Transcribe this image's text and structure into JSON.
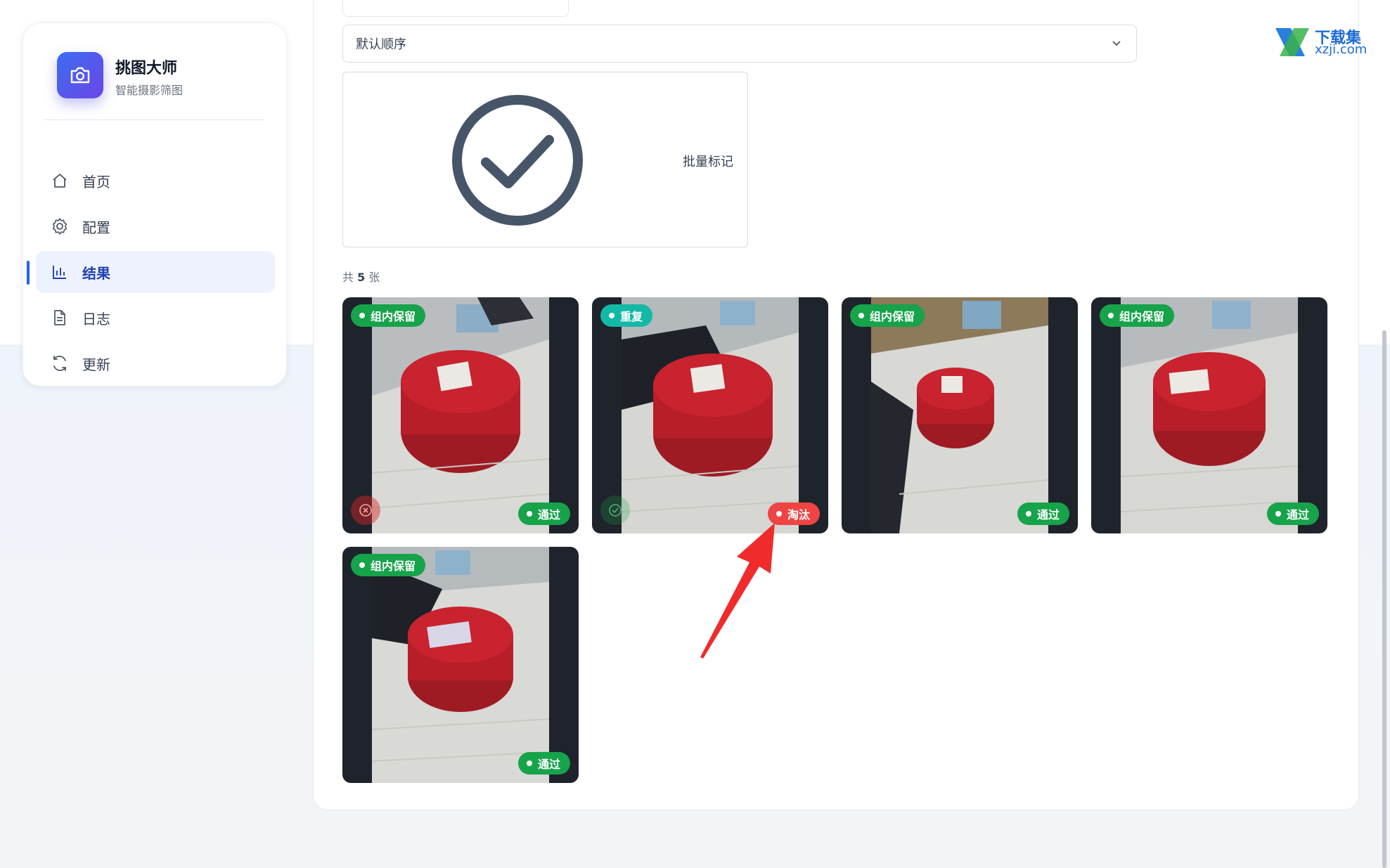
{
  "app": {
    "title": "挑图大师",
    "subtitle": "智能摄影筛图"
  },
  "sidebar": {
    "items": [
      {
        "label": "首页",
        "icon": "home-icon",
        "active": false
      },
      {
        "label": "配置",
        "icon": "gear-icon",
        "active": false
      },
      {
        "label": "结果",
        "icon": "bar-chart-icon",
        "active": true
      },
      {
        "label": "日志",
        "icon": "document-icon",
        "active": false
      },
      {
        "label": "更新",
        "icon": "refresh-icon",
        "active": false
      }
    ]
  },
  "toolbar": {
    "sort_select": {
      "value": "默认顺序"
    },
    "batch_label": "批量标记"
  },
  "results": {
    "count_prefix": "共",
    "count_value": "5",
    "count_suffix": "张",
    "cards": [
      {
        "top_tag": "组内保留",
        "bottom_tag": "通过",
        "top_status": "keep",
        "bottom_status": "pass",
        "mini": "x-circle"
      },
      {
        "top_tag": "重复",
        "bottom_tag": "淘汰",
        "top_status": "duplicate",
        "bottom_status": "reject",
        "mini": "check-circle"
      },
      {
        "top_tag": "组内保留",
        "bottom_tag": "通过",
        "top_status": "keep",
        "bottom_status": "pass"
      },
      {
        "top_tag": "组内保留",
        "bottom_tag": "通过",
        "top_status": "keep",
        "bottom_status": "pass"
      },
      {
        "top_tag": "组内保留",
        "bottom_tag": "通过",
        "top_status": "keep",
        "bottom_status": "pass"
      }
    ]
  },
  "watermark": {
    "line1": "下载集",
    "line2": "xzji.com"
  },
  "colors": {
    "accent": "#2563eb",
    "pass": "#16a34a",
    "reject": "#ef4444",
    "duplicate": "#14b8a6",
    "arrow": "#ef2b2b"
  }
}
